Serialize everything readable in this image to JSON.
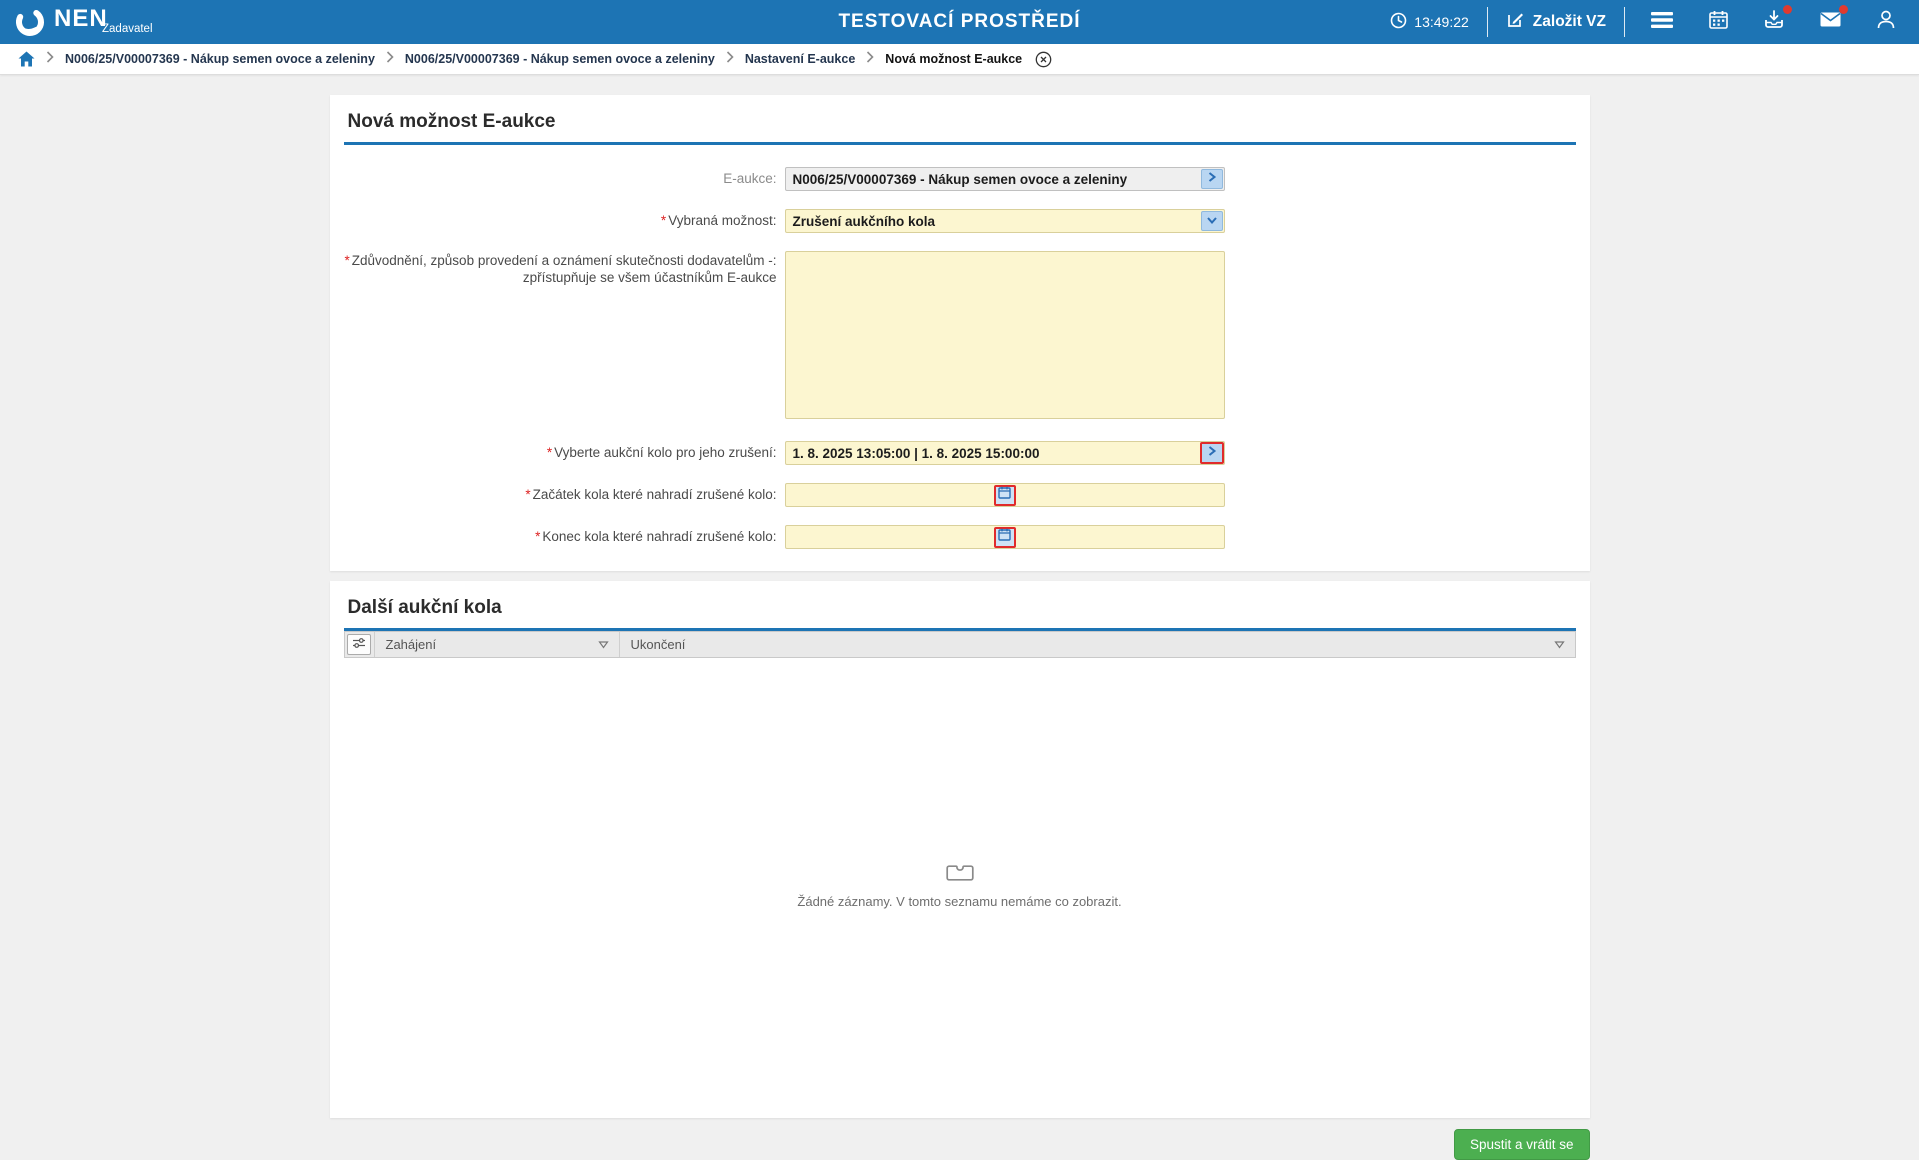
{
  "colors": {
    "accent_blue": "#1d74b4",
    "field_yellow": "#fcf6d0",
    "field_yellow_border": "#d9d09b",
    "readonly_gray": "#efefef",
    "chevron_button_blue": "#b9d6f2",
    "focus_red": "#e02b2b",
    "submit_green": "#4caf50",
    "badge_red": "#e03a2f",
    "navy_breadcrumb": "#24364f"
  },
  "header": {
    "brand_name": "NEN",
    "brand_role": "Zadavatel",
    "environment_title": "TESTOVACÍ PROSTŘEDÍ",
    "time": "13:49:22",
    "new_vz_label": "Založit VZ",
    "icon_names": [
      "clock-icon",
      "edit-icon",
      "menu-icon",
      "calendar-icon",
      "download-icon",
      "mail-icon",
      "user-icon"
    ],
    "download_badge": true,
    "mail_badge": true
  },
  "breadcrumb": {
    "items": [
      "N006/25/V00007369 - Nákup semen ovoce a zeleniny",
      "N006/25/V00007369 - Nákup semen ovoce a zeleniny",
      "Nastavení E-aukce",
      "Nová možnost E-aukce"
    ]
  },
  "form": {
    "title": "Nová možnost E-aukce",
    "required_marker": "*",
    "eaukce": {
      "label": "E-aukce:",
      "value": "N006/25/V00007369 - Nákup semen ovoce a zeleniny"
    },
    "vybrana_moznost": {
      "label": "Vybraná možnost:",
      "value": "Zrušení aukčního kola"
    },
    "zduvodneni": {
      "label_line1": "Zdůvodnění, způsob provedení a oznámení skutečnosti dodavatelům -:",
      "label_line2": "zpřístupňuje se všem účastníkům E-aukce",
      "value": ""
    },
    "aukcni_kolo": {
      "label": "Vyberte aukční kolo pro jeho zrušení:",
      "value": "1. 8. 2025 13:05:00 | 1. 8. 2025 15:00:00"
    },
    "zacatek": {
      "label": "Začátek kola které nahradí zrušené kolo:",
      "value": ""
    },
    "konec": {
      "label": "Konec kola které nahradí zrušené kolo:",
      "value": ""
    }
  },
  "table_section": {
    "title": "Další aukční kola",
    "columns": [
      "Zahájení",
      "Ukončení"
    ],
    "rows": [],
    "empty_message": "Žádné záznamy. V tomto seznamu nemáme co zobrazit."
  },
  "footer": {
    "submit_label": "Spustit a vrátit se"
  }
}
